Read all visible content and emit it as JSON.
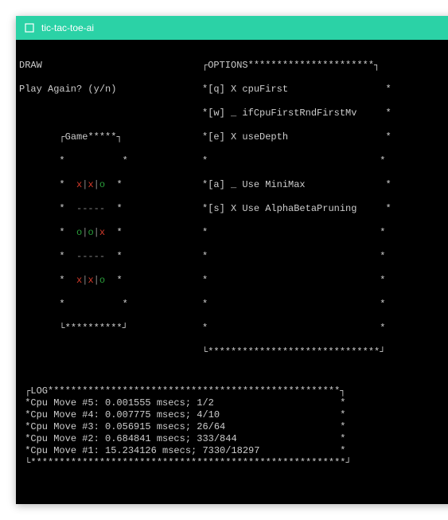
{
  "window": {
    "title": "tic-tac-toe-ai"
  },
  "game": {
    "result": "DRAW",
    "prompt": "Play Again? (y/n)",
    "panel_label": "Game",
    "board": {
      "r0": {
        "c0": "x",
        "c1": "x",
        "c2": "o"
      },
      "r1": {
        "c0": "o",
        "c1": "o",
        "c2": "x"
      },
      "r2": {
        "c0": "x",
        "c1": "x",
        "c2": "o"
      }
    }
  },
  "options": {
    "panel_label": "OPTIONS",
    "items": {
      "q": {
        "key": "[q]",
        "mark": "X",
        "label": "cpuFirst"
      },
      "w": {
        "key": "[w]",
        "mark": "_",
        "label": "ifCpuFirstRndFirstMv"
      },
      "e": {
        "key": "[e]",
        "mark": "X",
        "label": "useDepth"
      },
      "a": {
        "key": "[a]",
        "mark": "_",
        "label": "Use MiniMax"
      },
      "s": {
        "key": "[s]",
        "mark": "X",
        "label": "Use AlphaBetaPruning"
      }
    }
  },
  "log": {
    "panel_label": "LOG",
    "entries": {
      "e0": "Cpu Move #5: 0.001555 msecs; 1/2",
      "e1": "Cpu Move #4: 0.007775 msecs; 4/10",
      "e2": "Cpu Move #3: 0.056915 msecs; 26/64",
      "e3": "Cpu Move #2: 0.684841 msecs; 333/844",
      "e4": "Cpu Move #1: 15.234126 msecs; 7330/18297"
    }
  }
}
